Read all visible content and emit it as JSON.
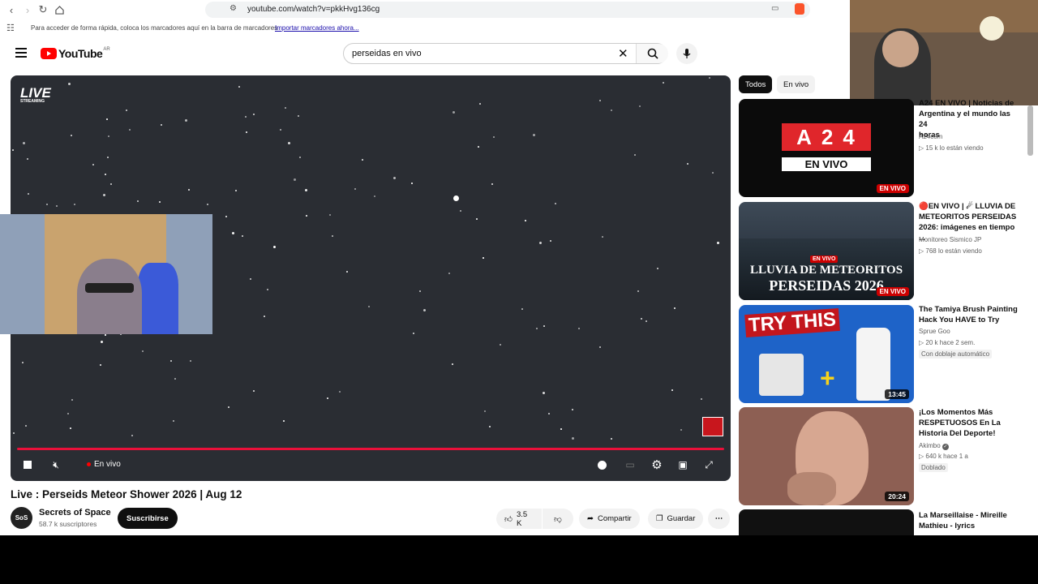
{
  "browser": {
    "url": "youtube.com/watch?v=pkkHvg136cg",
    "bookmarks_hint": "Para acceder de forma rápida, coloca los marcadores aquí en la barra de marcadores",
    "bookmarks_link": "Importar marcadores ahora..."
  },
  "header": {
    "logo_text": "YouTube",
    "country": "AR",
    "search_value": "perseidas en vivo"
  },
  "player": {
    "live_logo": "LIVE",
    "live_logo_sub": "STREAMING",
    "live_label": "En vivo",
    "progress": 1.0
  },
  "video": {
    "title": "Live : Perseids Meteor Shower 2026 | Aug 12",
    "channel": "Secrets of Space",
    "channel_avatar": "SoS",
    "subscribers": "58.7 k suscriptores",
    "subscribe_label": "Suscribirse",
    "likes": "3.5 K",
    "share_label": "Compartir",
    "save_label": "Guardar"
  },
  "sidebar": {
    "chips": [
      "Todos",
      "En vivo"
    ],
    "items": [
      {
        "title_line1": "A24 EN VIVO | Noticias de",
        "title_line2": "Argentina y el mundo las 24",
        "title_line3": "horas",
        "channel": "A24com",
        "meta": "15 k lo están viendo",
        "badge": "EN VIVO",
        "thumb_text1": "A24",
        "thumb_text2": "EN VIVO"
      },
      {
        "title_line1": "🔴EN VIVO | ☄ LLUVIA DE",
        "title_line2": "METEORITOS PERSEIDAS",
        "title_line3": "2026: imágenes en tiempo ...",
        "channel": "Monitoreo Sismico JP",
        "meta": "768 lo están viendo",
        "badge": "EN VIVO",
        "thumb_text1": "LLUVIA DE METEORITOS",
        "thumb_text2": "PERSEIDAS 2026",
        "thumb_chip": "EN VIVO"
      },
      {
        "title_line1": "The Tamiya Brush Painting",
        "title_line2": "Hack You HAVE to Try",
        "title_line3": "",
        "channel": "Sprue Goo",
        "meta": "20 k  hace 2 sem.",
        "extra": "Con doblaje automático",
        "duration": "13:45",
        "thumb_text1": "TRY THIS"
      },
      {
        "title_line1": "¡Los Momentos Más",
        "title_line2": "RESPETUOSOS En La",
        "title_line3": "Historia Del Deporte!",
        "channel": "Akimbo",
        "meta": "640 k  hace 1 a",
        "extra": "Doblado",
        "duration": "20:24"
      },
      {
        "title_line1": "La Marseillaise - Mireille",
        "title_line2": "Mathieu - lyrics",
        "title_line3": "",
        "channel": "",
        "meta": ""
      }
    ]
  },
  "colors": {
    "accent": "#e9103a",
    "live": "#cc0000",
    "yt_red": "#ff0000"
  }
}
